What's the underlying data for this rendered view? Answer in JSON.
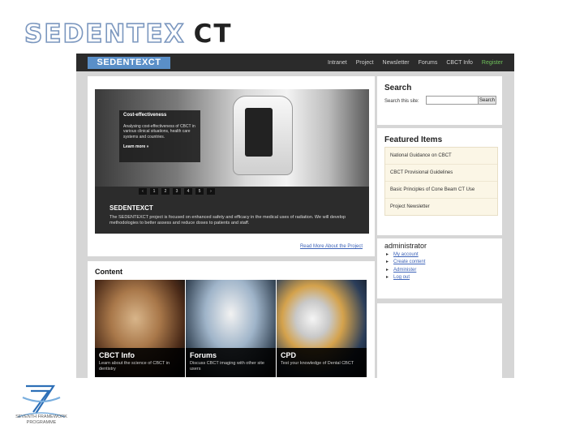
{
  "brand": {
    "part1": "SEDENTEX",
    "part2": "CT"
  },
  "site": {
    "logo": "SEDENTEXCT",
    "nav": [
      "Intranet",
      "Project",
      "Newsletter",
      "Forums",
      "CBCT Info",
      "Register"
    ],
    "colors": {
      "accent": "#5a8fc8",
      "register": "#6ec05a",
      "link": "#3d63b8"
    }
  },
  "slider": {
    "overlay_title": "Cost-effectiveness",
    "overlay_text": "Analysing cost-effectiveness of CBCT in various clinical situations, health care systems and countries.",
    "overlay_more": "Learn more »",
    "pager": [
      "‹",
      "1",
      "2",
      "3",
      "4",
      "5",
      "›"
    ],
    "heading": "SEDENTEXCT",
    "text": "The SEDENTEXCT project is focused on enhanced safety and efficacy in the medical uses of radiation. We will develop methodologies to better assess and reduce doses to patients and staff."
  },
  "main": {
    "read_more": "Read More About the Project",
    "content_heading": "Content",
    "tiles": [
      {
        "title": "CBCT Info",
        "desc": "Learn about the science of CBCT in dentistry"
      },
      {
        "title": "Forums",
        "desc": "Discuss CBCT imaging with other site users"
      },
      {
        "title": "CPD",
        "desc": "Test your knowledge of Dental CBCT"
      }
    ]
  },
  "sidebar": {
    "search": {
      "heading": "Search",
      "label": "Search this site:",
      "value": "",
      "button": "Search"
    },
    "featured": {
      "heading": "Featured Items",
      "items": [
        "National Guidance on CBCT",
        "CBCT Provisional Guidelines",
        "Basic Principles of Cone Beam CT Use",
        "Project Newsletter"
      ]
    },
    "admin": {
      "heading": "administrator",
      "items": [
        "My account",
        "Create content",
        "Administer",
        "Log out"
      ]
    }
  },
  "footer_logo": {
    "line1": "SEVENTH FRAMEWORK",
    "line2": "PROGRAMME"
  }
}
